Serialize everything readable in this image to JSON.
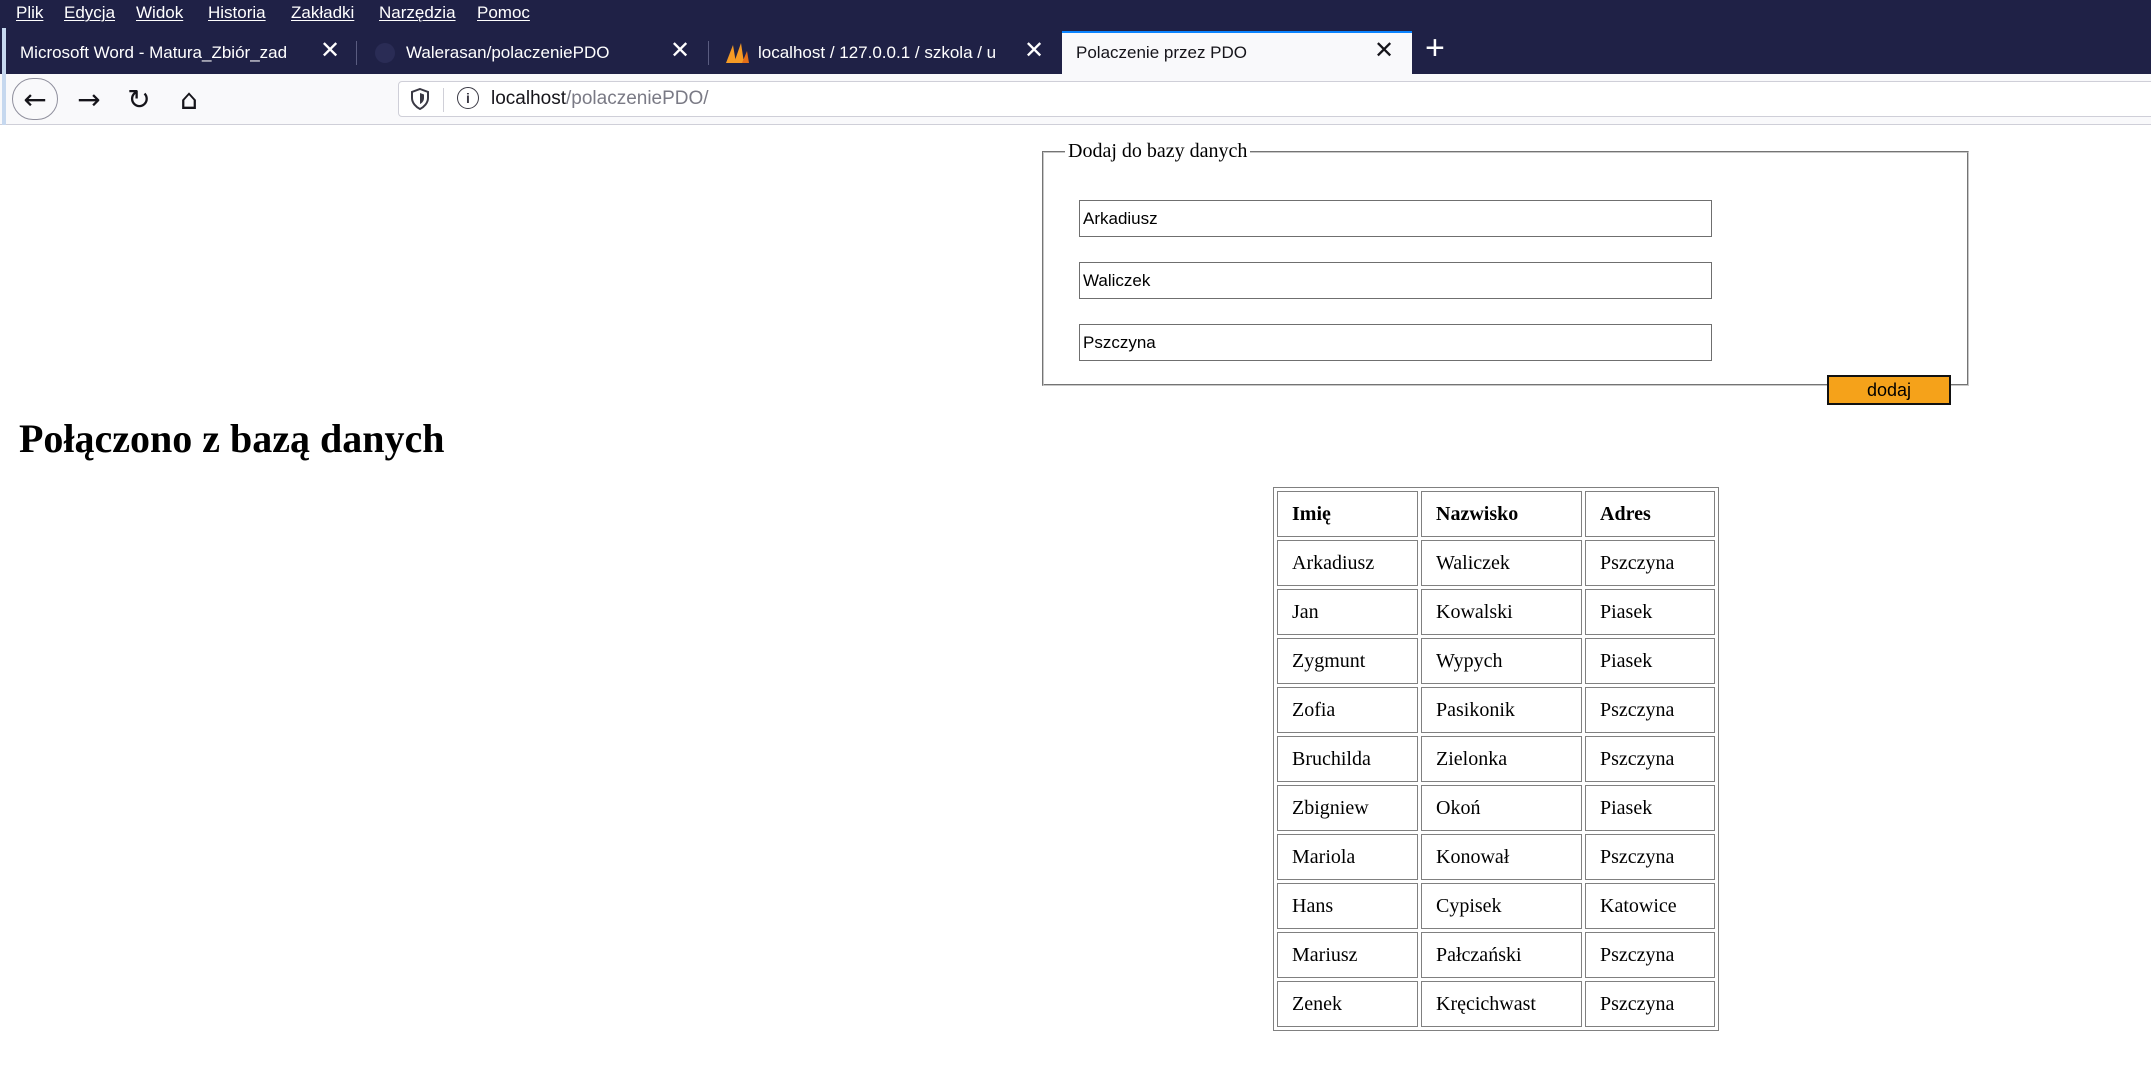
{
  "menubar": {
    "items": [
      "Plik",
      "Edycja",
      "Widok",
      "Historia",
      "Zakładki",
      "Narzędzia",
      "Pomoc"
    ]
  },
  "tabs": [
    {
      "label": "Microsoft Word - Matura_Zbiór_zad",
      "close": "✕"
    },
    {
      "label": "Walerasan/polaczeniePDO",
      "close": "✕"
    },
    {
      "label": "localhost / 127.0.0.1 / szkola / u",
      "close": "✕"
    },
    {
      "label": "Polaczenie przez PDO",
      "close": "✕",
      "active": true
    }
  ],
  "new_tab": "+",
  "nav": {
    "back": "←",
    "forward": "→",
    "reload": "↻",
    "home": "⌂",
    "url_host": "localhost",
    "url_path": "/polaczeniePDO/"
  },
  "form": {
    "legend": "Dodaj do bazy danych",
    "fields": [
      "Arkadiusz",
      "Waliczek",
      "Pszczyna"
    ],
    "submit_label": "dodaj"
  },
  "status_heading": "Połączono z bazą danych",
  "table": {
    "headers": [
      "Imię",
      "Nazwisko",
      "Adres"
    ],
    "rows": [
      [
        "Arkadiusz",
        "Waliczek",
        "Pszczyna"
      ],
      [
        "Jan",
        "Kowalski",
        "Piasek"
      ],
      [
        "Zygmunt",
        "Wypych",
        "Piasek"
      ],
      [
        "Zofia",
        "Pasikonik",
        "Pszczyna"
      ],
      [
        "Bruchilda",
        "Zielonka",
        "Pszczyna"
      ],
      [
        "Zbigniew",
        "Okoń",
        "Piasek"
      ],
      [
        "Mariola",
        "Konował",
        "Pszczyna"
      ],
      [
        "Hans",
        "Cypisek",
        "Katowice"
      ],
      [
        "Mariusz",
        "Pałczański",
        "Pszczyna"
      ],
      [
        "Zenek",
        "Kręcichwast",
        "Pszczyna"
      ]
    ]
  },
  "colors": {
    "chrome_dark": "#1f2146",
    "active_tab_accent": "#0a84ff",
    "submit_button": "#f5a21a"
  }
}
